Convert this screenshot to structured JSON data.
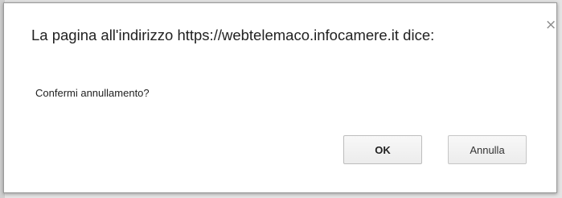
{
  "dialog": {
    "title": "La pagina all'indirizzo https://webtelemaco.infocamere.it dice:",
    "message": "Confermi annullamento?",
    "close_icon": "×",
    "ok_label": "OK",
    "cancel_label": "Annulla"
  }
}
